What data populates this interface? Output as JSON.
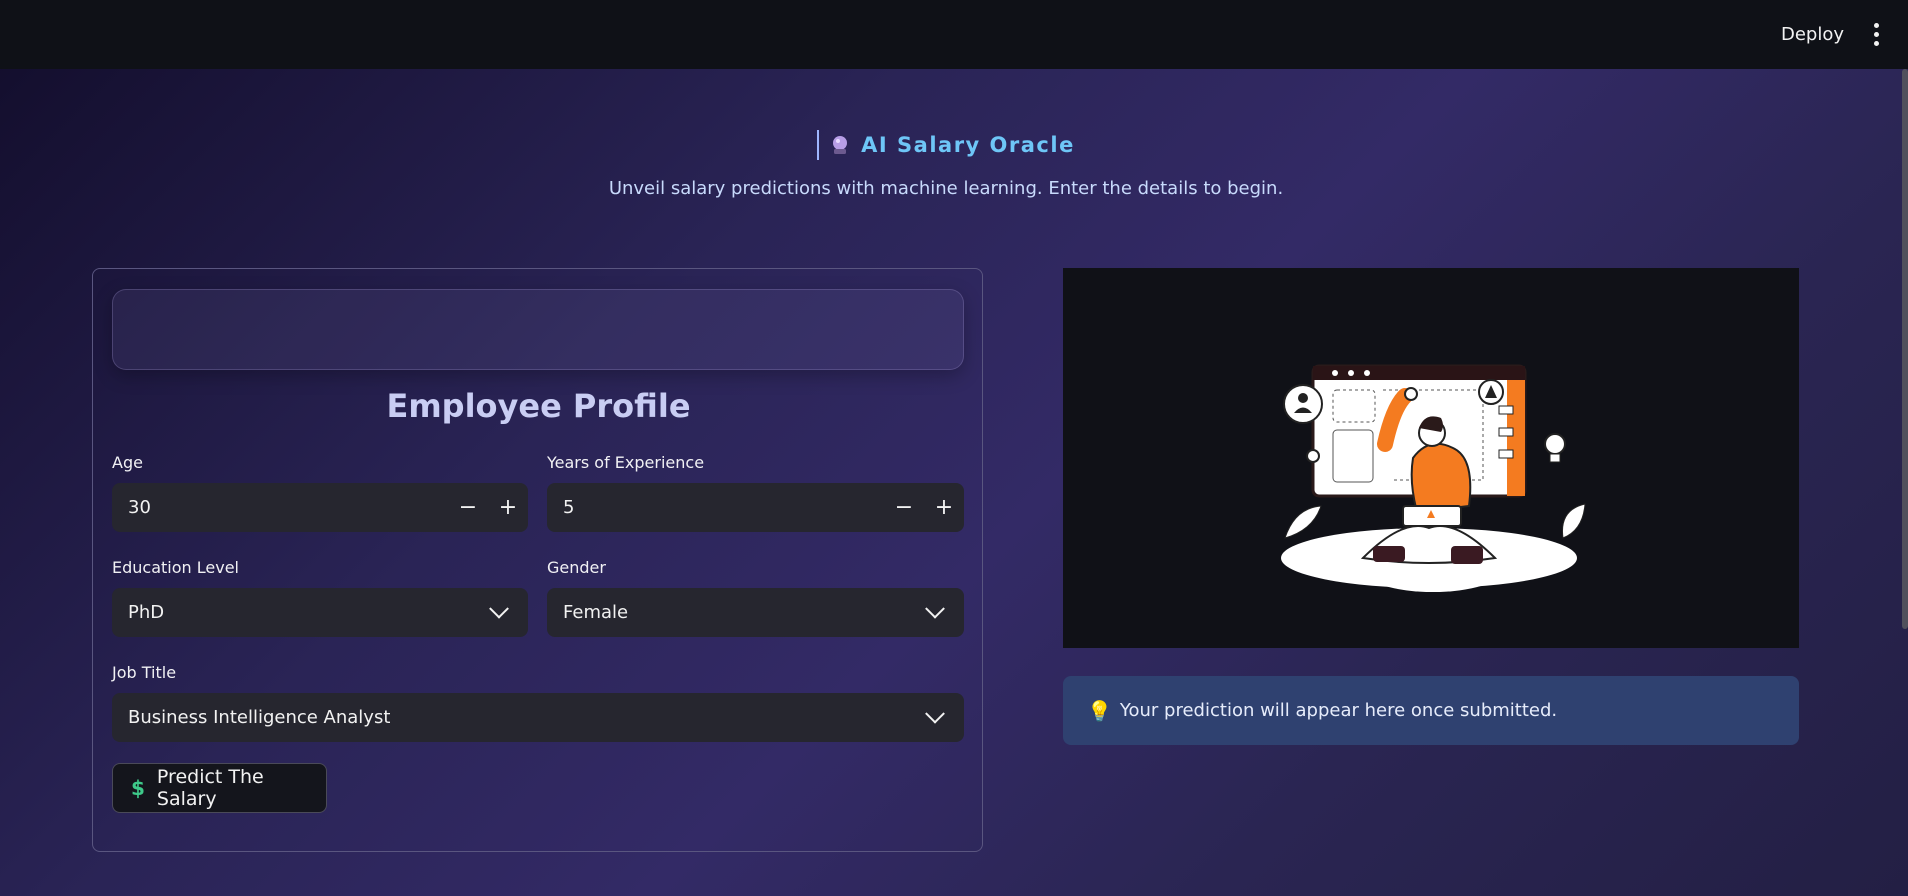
{
  "topbar": {
    "deploy_label": "Deploy",
    "menu_icon": "vertical-ellipsis-icon"
  },
  "header": {
    "icon": "crystal-ball-icon",
    "title": "AI Salary Oracle",
    "subtitle": "Unveil salary predictions with machine learning. Enter the details to begin."
  },
  "form": {
    "title": "Employee Profile",
    "age": {
      "label": "Age",
      "value": "30"
    },
    "experience": {
      "label": "Years of Experience",
      "value": "5"
    },
    "education": {
      "label": "Education Level",
      "value": "PhD"
    },
    "gender": {
      "label": "Gender",
      "value": "Female"
    },
    "job_title": {
      "label": "Job Title",
      "value": "Business Intelligence Analyst"
    },
    "stepper_minus": "−",
    "stepper_plus": "+",
    "submit": {
      "icon": "dollar-icon",
      "label": "Predict The Salary"
    }
  },
  "result": {
    "icon": "lightbulb-icon",
    "message": "Your prediction will appear here once submitted."
  },
  "colors": {
    "accent": "#6ec6f7",
    "info_bg": "#2f4170",
    "illustration_orange": "#f47b20"
  }
}
